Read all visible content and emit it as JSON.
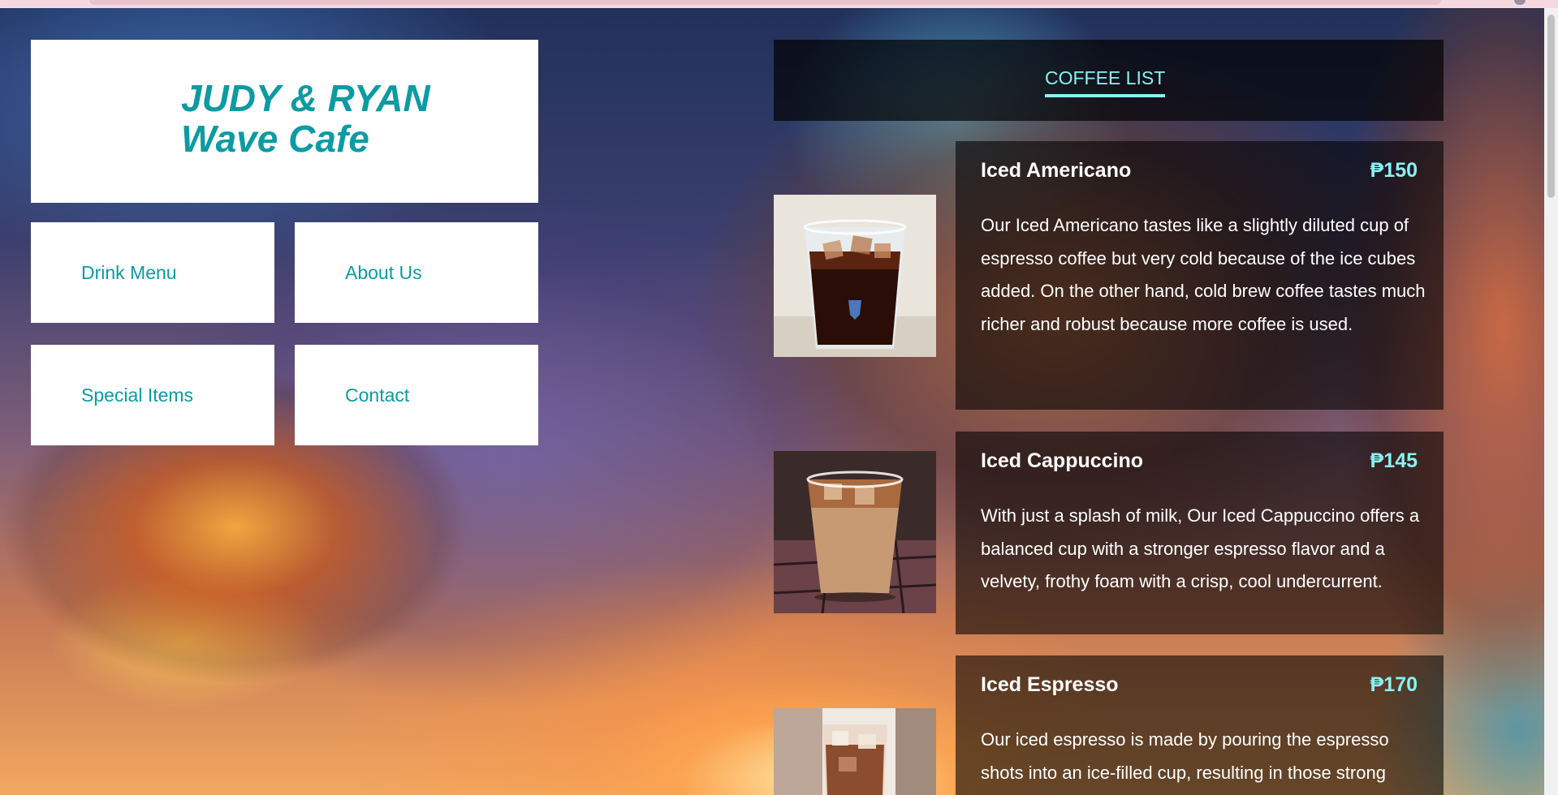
{
  "brand": {
    "line1": "JUDY & RYAN",
    "line2": "Wave Cafe",
    "color": "#0c9ba3"
  },
  "nav": [
    {
      "label": "Drink Menu"
    },
    {
      "label": "About Us"
    },
    {
      "label": "Special Items"
    },
    {
      "label": "Contact"
    }
  ],
  "coffee_list": {
    "tab_label": "COFFEE LIST",
    "accent": "#89f2f2",
    "items": [
      {
        "name": "Iced Americano",
        "price": "₱150",
        "description": "Our Iced Americano tastes like a slightly diluted cup of espresso coffee but very cold because of the ice cubes added. On the other hand, cold brew coffee tastes much richer and robust because more coffee is used.",
        "image": "iced-americano-photo"
      },
      {
        "name": "Iced Cappuccino",
        "price": "₱145",
        "description": "With just a splash of milk, Our Iced Cappuccino offers a balanced cup with a stronger espresso flavor and a velvety, frothy foam with a crisp, cool undercurrent.",
        "image": "iced-cappuccino-photo"
      },
      {
        "name": "Iced Espresso",
        "price": "₱170",
        "description": "Our iced espresso is made by pouring the espresso shots into an ice-filled cup, resulting in those strong",
        "image": "iced-espresso-photo"
      }
    ]
  }
}
